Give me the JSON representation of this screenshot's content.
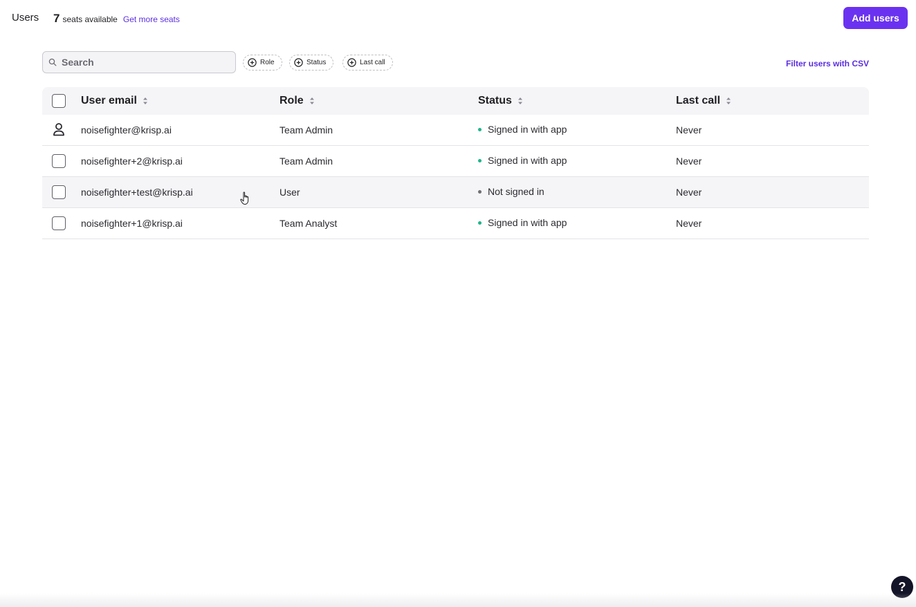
{
  "header": {
    "title": "Users",
    "seats_count": "7",
    "seats_label": "seats available",
    "get_more_label": "Get more seats",
    "add_users_label": "Add users"
  },
  "toolbar": {
    "search_placeholder": "Search",
    "filters": [
      {
        "label": "Role",
        "icon": "plus-circle-icon"
      },
      {
        "label": "Status",
        "icon": "plus-circle-icon"
      },
      {
        "label": "Last call",
        "icon": "plus-circle-icon"
      }
    ],
    "csv_link_label": "Filter users with CSV"
  },
  "table": {
    "columns": [
      "User email",
      "Role",
      "Status",
      "Last call"
    ],
    "rows": [
      {
        "email": "noisefighter@krisp.ai",
        "role": "Team Admin",
        "status": "Signed in with app",
        "status_color": "#1fb58a",
        "last_call": "Never",
        "selector": "user-icon"
      },
      {
        "email": "noisefighter+2@krisp.ai",
        "role": "Team Admin",
        "status": "Signed in with app",
        "status_color": "#1fb58a",
        "last_call": "Never",
        "selector": "checkbox"
      },
      {
        "email": "noisefighter+test@krisp.ai",
        "role": "User",
        "status": "Not signed in",
        "status_color": "#6e6e76",
        "last_call": "Never",
        "selector": "checkbox"
      },
      {
        "email": "noisefighter+1@krisp.ai",
        "role": "Team Analyst",
        "status": "Signed in with app",
        "status_color": "#1fb58a",
        "last_call": "Never",
        "selector": "checkbox"
      }
    ]
  },
  "help": {
    "label": "?"
  },
  "colors": {
    "accent": "#6a32f0",
    "link": "#5a2ee0",
    "status_signed_in": "#1fb58a",
    "status_not_signed_in": "#6e6e76"
  }
}
